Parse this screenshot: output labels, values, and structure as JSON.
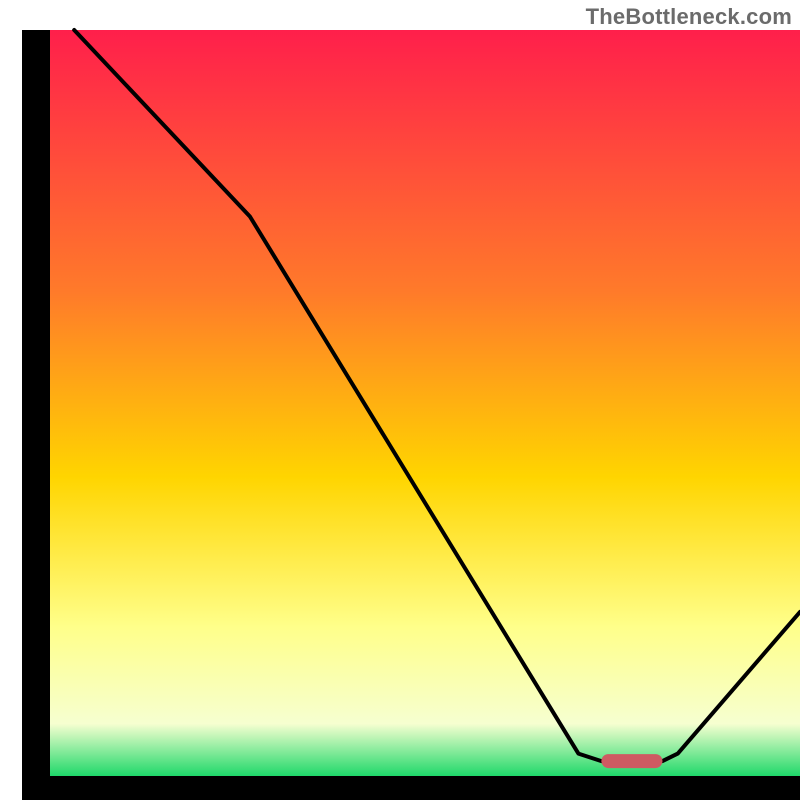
{
  "watermark": "TheBottleneck.com",
  "chart_data": {
    "type": "line",
    "title": "",
    "xlabel": "",
    "ylabel": "",
    "xlim": [
      0,
      100
    ],
    "ylim": [
      0,
      100
    ],
    "background_gradient_stops": [
      {
        "offset": 0.0,
        "color": "#ff1f4b"
      },
      {
        "offset": 0.35,
        "color": "#ff7a2a"
      },
      {
        "offset": 0.6,
        "color": "#ffd500"
      },
      {
        "offset": 0.8,
        "color": "#ffff8a"
      },
      {
        "offset": 0.93,
        "color": "#f6ffd0"
      },
      {
        "offset": 1.0,
        "color": "#1fd86a"
      }
    ],
    "series": [
      {
        "name": "curve",
        "x": [
          5,
          28,
          71,
          74,
          82,
          84,
          100
        ],
        "y": [
          100,
          75,
          3,
          2,
          2,
          3,
          22
        ]
      }
    ],
    "marker": {
      "name": "optimal-range",
      "x": [
        74,
        82
      ],
      "y": 2,
      "color": "#ce5a62"
    },
    "axes_color": "#000000",
    "line_color": "#000000"
  }
}
